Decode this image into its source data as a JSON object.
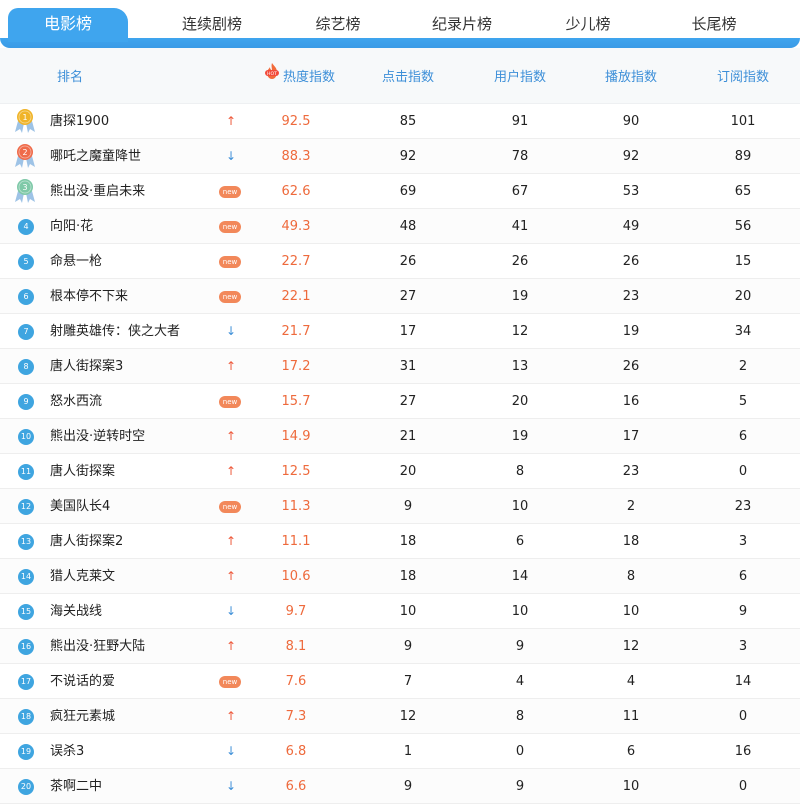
{
  "tabs": [
    {
      "label": "电影榜",
      "active": true
    },
    {
      "label": "连续剧榜",
      "active": false
    },
    {
      "label": "综艺榜",
      "active": false
    },
    {
      "label": "纪录片榜",
      "active": false
    },
    {
      "label": "少儿榜",
      "active": false
    },
    {
      "label": "长尾榜",
      "active": false
    }
  ],
  "header": {
    "rank": "排名",
    "hot_badge": "HOT",
    "heat": "热度指数",
    "click": "点击指数",
    "user": "用户指数",
    "play": "播放指数",
    "subscribe": "订阅指数"
  },
  "new_label": "new",
  "colors": {
    "accent": "#3fa5ee",
    "up": "#ee5a3c",
    "down": "#3d8fd8",
    "heat": "#ee6a3c",
    "new_badge": "#f2885a"
  },
  "rows": [
    {
      "rank": "1",
      "title": "唐探1900",
      "trend": "up",
      "trend_symbol": "↑",
      "heat": "92.5",
      "click": "85",
      "user": "91",
      "play": "90",
      "subscribe": "101"
    },
    {
      "rank": "2",
      "title": "哪吒之魔童降世",
      "trend": "down",
      "trend_symbol": "↓",
      "heat": "88.3",
      "click": "92",
      "user": "78",
      "play": "92",
      "subscribe": "89"
    },
    {
      "rank": "3",
      "title": "熊出没·重启未来",
      "trend": "new",
      "trend_symbol": "",
      "heat": "62.6",
      "click": "69",
      "user": "67",
      "play": "53",
      "subscribe": "65"
    },
    {
      "rank": "4",
      "title": "向阳·花",
      "trend": "new",
      "trend_symbol": "",
      "heat": "49.3",
      "click": "48",
      "user": "41",
      "play": "49",
      "subscribe": "56"
    },
    {
      "rank": "5",
      "title": "命悬一枪",
      "trend": "new",
      "trend_symbol": "",
      "heat": "22.7",
      "click": "26",
      "user": "26",
      "play": "26",
      "subscribe": "15"
    },
    {
      "rank": "6",
      "title": "根本停不下来",
      "trend": "new",
      "trend_symbol": "",
      "heat": "22.1",
      "click": "27",
      "user": "19",
      "play": "23",
      "subscribe": "20"
    },
    {
      "rank": "7",
      "title": "射雕英雄传：侠之大者",
      "trend": "down",
      "trend_symbol": "↓",
      "heat": "21.7",
      "click": "17",
      "user": "12",
      "play": "19",
      "subscribe": "34"
    },
    {
      "rank": "8",
      "title": "唐人街探案3",
      "trend": "up",
      "trend_symbol": "↑",
      "heat": "17.2",
      "click": "31",
      "user": "13",
      "play": "26",
      "subscribe": "2"
    },
    {
      "rank": "9",
      "title": "怒水西流",
      "trend": "new",
      "trend_symbol": "",
      "heat": "15.7",
      "click": "27",
      "user": "20",
      "play": "16",
      "subscribe": "5"
    },
    {
      "rank": "10",
      "title": "熊出没·逆转时空",
      "trend": "up",
      "trend_symbol": "↑",
      "heat": "14.9",
      "click": "21",
      "user": "19",
      "play": "17",
      "subscribe": "6"
    },
    {
      "rank": "11",
      "title": "唐人街探案",
      "trend": "up",
      "trend_symbol": "↑",
      "heat": "12.5",
      "click": "20",
      "user": "8",
      "play": "23",
      "subscribe": "0"
    },
    {
      "rank": "12",
      "title": "美国队长4",
      "trend": "new",
      "trend_symbol": "",
      "heat": "11.3",
      "click": "9",
      "user": "10",
      "play": "2",
      "subscribe": "23"
    },
    {
      "rank": "13",
      "title": "唐人街探案2",
      "trend": "up",
      "trend_symbol": "↑",
      "heat": "11.1",
      "click": "18",
      "user": "6",
      "play": "18",
      "subscribe": "3"
    },
    {
      "rank": "14",
      "title": "猎人克莱文",
      "trend": "up",
      "trend_symbol": "↑",
      "heat": "10.6",
      "click": "18",
      "user": "14",
      "play": "8",
      "subscribe": "6"
    },
    {
      "rank": "15",
      "title": "海关战线",
      "trend": "down",
      "trend_symbol": "↓",
      "heat": "9.7",
      "click": "10",
      "user": "10",
      "play": "10",
      "subscribe": "9"
    },
    {
      "rank": "16",
      "title": "熊出没·狂野大陆",
      "trend": "up",
      "trend_symbol": "↑",
      "heat": "8.1",
      "click": "9",
      "user": "9",
      "play": "12",
      "subscribe": "3"
    },
    {
      "rank": "17",
      "title": "不说话的爱",
      "trend": "new",
      "trend_symbol": "",
      "heat": "7.6",
      "click": "7",
      "user": "4",
      "play": "4",
      "subscribe": "14"
    },
    {
      "rank": "18",
      "title": "疯狂元素城",
      "trend": "up",
      "trend_symbol": "↑",
      "heat": "7.3",
      "click": "12",
      "user": "8",
      "play": "11",
      "subscribe": "0"
    },
    {
      "rank": "19",
      "title": "误杀3",
      "trend": "down",
      "trend_symbol": "↓",
      "heat": "6.8",
      "click": "1",
      "user": "0",
      "play": "6",
      "subscribe": "16"
    },
    {
      "rank": "20",
      "title": "茶啊二中",
      "trend": "down",
      "trend_symbol": "↓",
      "heat": "6.6",
      "click": "9",
      "user": "9",
      "play": "10",
      "subscribe": "0"
    }
  ]
}
